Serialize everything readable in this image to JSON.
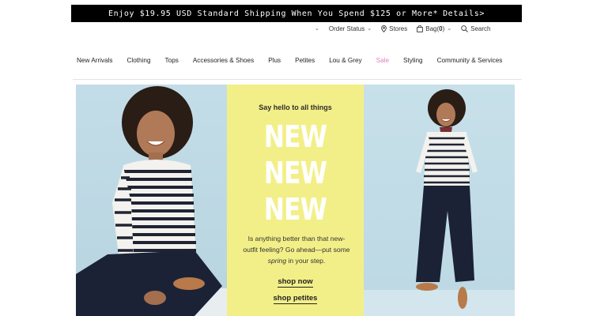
{
  "promo": {
    "text": "Enjoy $19.95 USD Standard Shipping When You Spend $125 or More*",
    "details": "Details>"
  },
  "utility": {
    "order_status": "Order Status",
    "stores": "Stores",
    "bag_label": "Bag",
    "bag_open": "(",
    "bag_count": "0",
    "bag_close": ")",
    "search": "Search"
  },
  "nav": {
    "items": [
      "New Arrivals",
      "Clothing",
      "Tops",
      "Accessories & Shoes",
      "Plus",
      "Petites",
      "Lou & Grey",
      "Sale",
      "Styling",
      "Community & Services"
    ]
  },
  "hero": {
    "kicker": "Say hello to all things",
    "headline": [
      "NEW",
      "NEW",
      "NEW"
    ],
    "copy_1": "Is anything better than that new-outfit feeling? Go ahead—put some ",
    "copy_em": "spring",
    "copy_2": " in your step.",
    "cta_primary": "shop now",
    "cta_secondary": "shop petites"
  },
  "colors": {
    "promo_bg": "#000000",
    "sale": "#e080b8",
    "hero_mid_bg": "#f3ef88",
    "hero_side_bg": "#c3dde8"
  }
}
